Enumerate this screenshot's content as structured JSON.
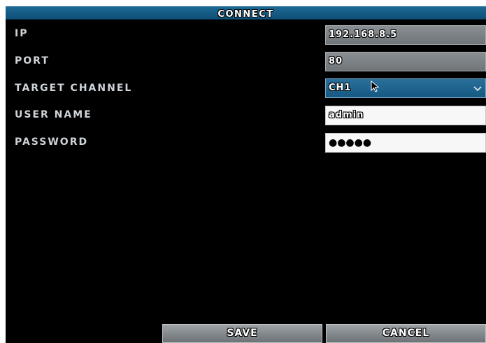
{
  "dialog": {
    "title": "CONNECT"
  },
  "fields": {
    "ip": {
      "label": "IP",
      "value": "192.168.8.5"
    },
    "port": {
      "label": "PORT",
      "value": "80"
    },
    "channel": {
      "label": "TARGET CHANNEL",
      "value": "CH1"
    },
    "user": {
      "label": "USER NAME",
      "value": "admin"
    },
    "password": {
      "label": "PASSWORD",
      "value": "●●●●●"
    }
  },
  "buttons": {
    "save": "SAVE",
    "cancel": "CANCEL"
  },
  "colors": {
    "title_bar": "#1d6a95",
    "background": "#000000",
    "select": "#1f6590",
    "button": "#85898d"
  }
}
